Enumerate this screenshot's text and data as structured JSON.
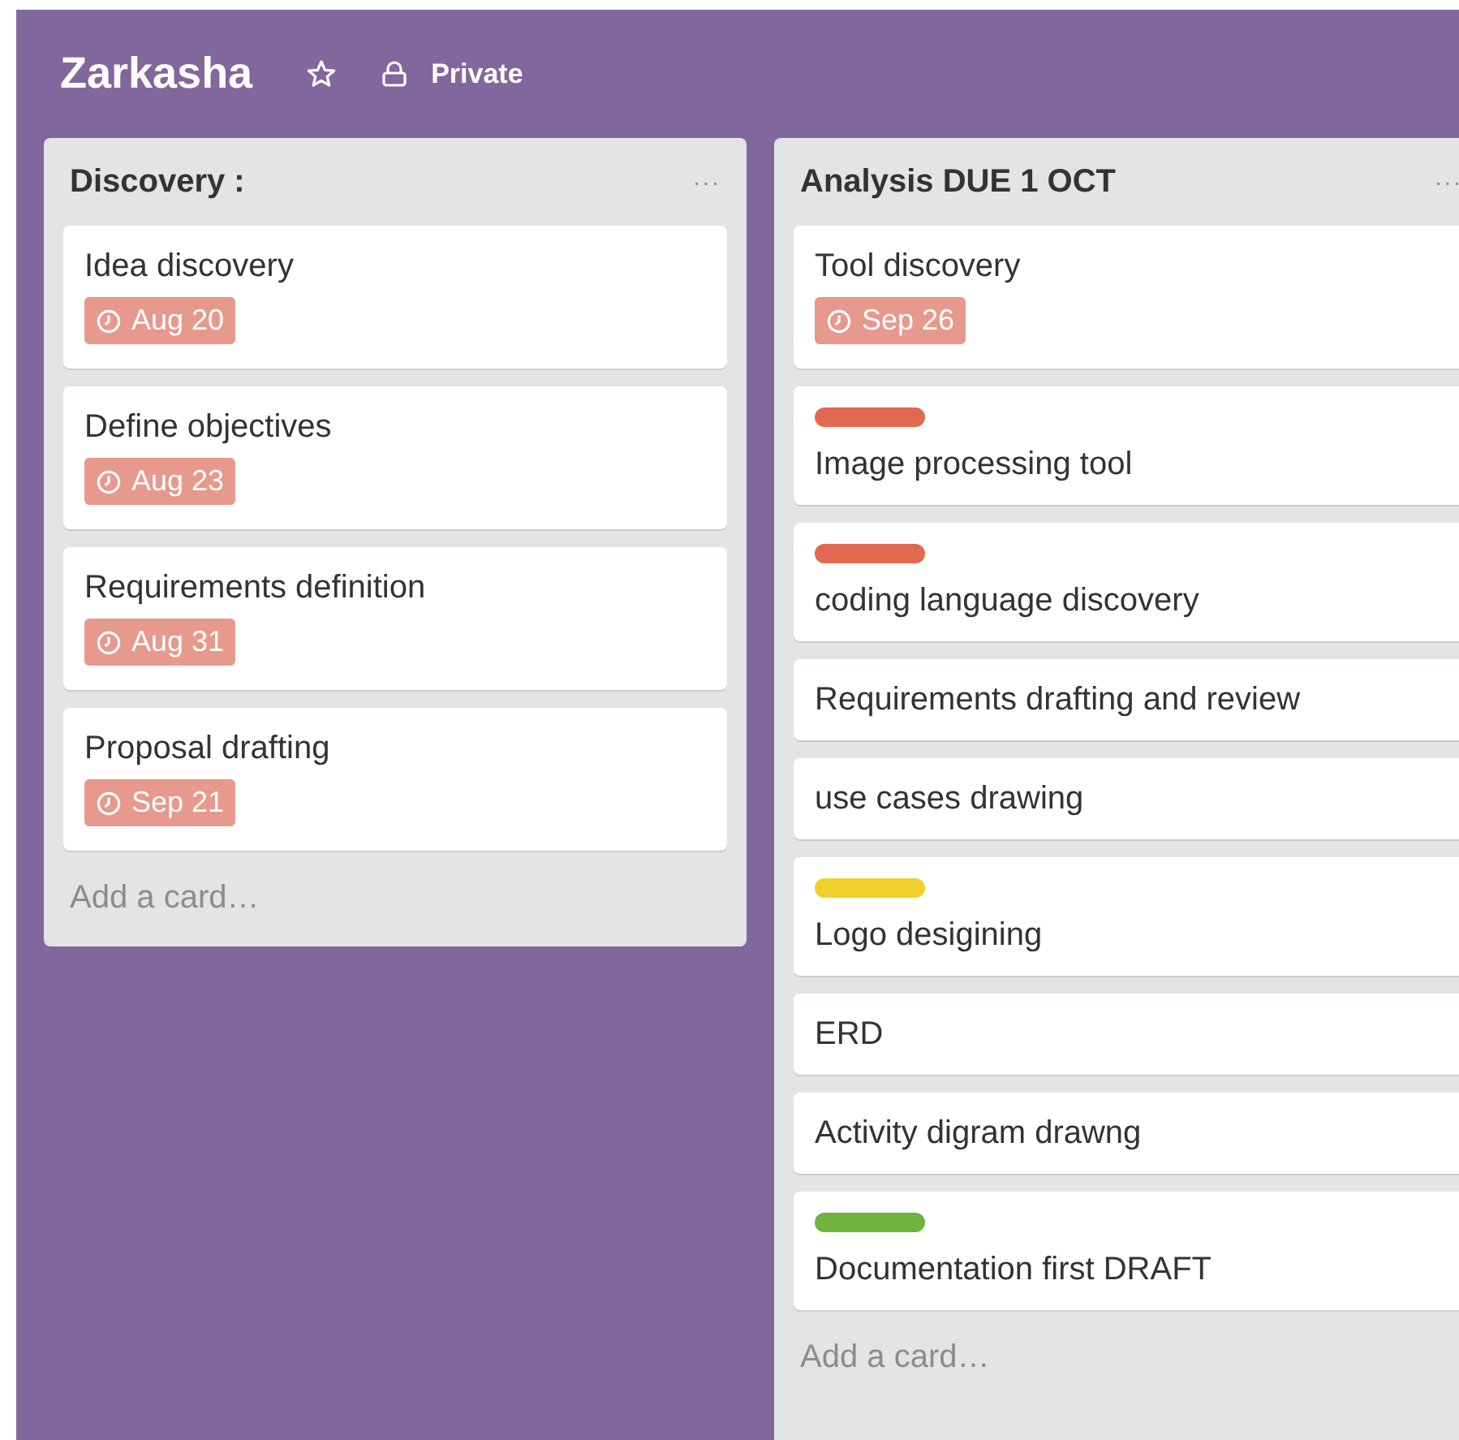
{
  "board": {
    "title": "Zarkasha",
    "starred": false,
    "visibility": "Private"
  },
  "lists": [
    {
      "title": "Discovery :",
      "menu": "···",
      "add_card": "Add a card…",
      "cards": [
        {
          "title": "Idea discovery",
          "due": "Aug 20"
        },
        {
          "title": "Define objectives",
          "due": "Aug 23"
        },
        {
          "title": "Requirements definition",
          "due": "Aug 31"
        },
        {
          "title": "Proposal drafting",
          "due": "Sep 21"
        }
      ]
    },
    {
      "title": "Analysis DUE 1 OCT",
      "menu": "···",
      "add_card": "Add a card…",
      "cards": [
        {
          "title": "Tool discovery",
          "due": "Sep 26"
        },
        {
          "title": "Image processing tool",
          "color": "#e0694f"
        },
        {
          "title": "coding language discovery",
          "color": "#e0694f"
        },
        {
          "title": "Requirements drafting and review"
        },
        {
          "title": "use cases drawing"
        },
        {
          "title": "Logo desigining",
          "color": "#f2d02b"
        },
        {
          "title": "ERD"
        },
        {
          "title": "Activity digram drawng"
        },
        {
          "title": "Documentation first DRAFT",
          "color": "#6fb33f"
        }
      ]
    }
  ]
}
